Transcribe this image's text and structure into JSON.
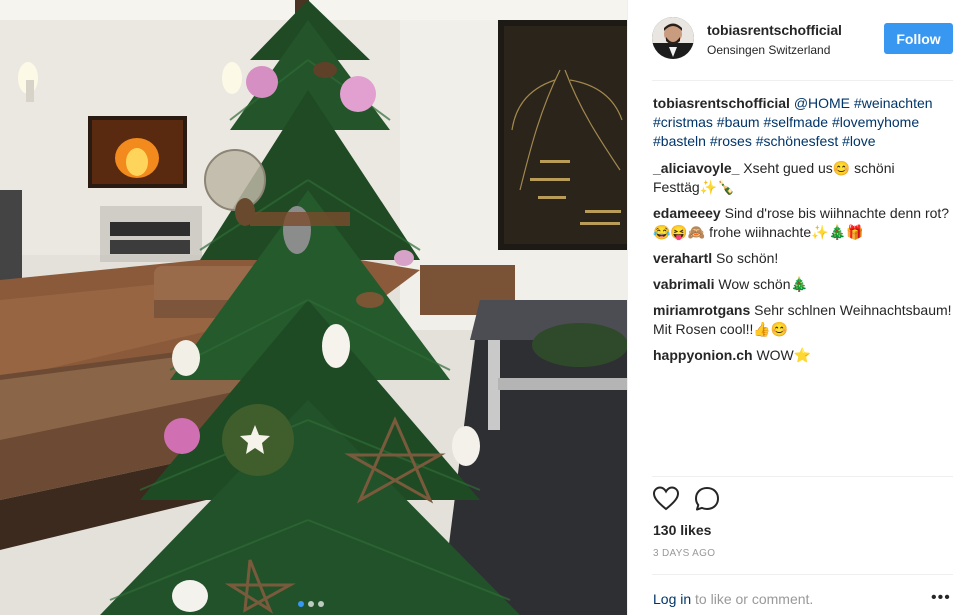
{
  "header": {
    "username": "tobiasrentschofficial",
    "location": "Oensingen Switzerland",
    "follow_label": "Follow"
  },
  "caption": {
    "username": "tobiasrentschofficial",
    "mention": "@HOME",
    "hashtags": "#weinachten #cristmas #baum #selfmade #lovemyhome #basteln #roses #schönesfest #love"
  },
  "comments": [
    {
      "username": "_aliciavoyle_",
      "text": "Xseht gued us😊 schöni Festtäg✨🍾"
    },
    {
      "username": "edameeey",
      "text": "Sind d'rose bis wiihnachte denn rot? 😂😝🙈 frohe wiihnachte✨🎄🎁"
    },
    {
      "username": "verahartl",
      "text": "So schön!"
    },
    {
      "username": "vabrimali",
      "text": "Wow schön🎄"
    },
    {
      "username": "miriamrotgans",
      "text": "Sehr schlnen Weihnachtsbaum! Mit Rosen cool!!👍😊"
    },
    {
      "username": "happyonion.ch",
      "text": "WOW⭐"
    }
  ],
  "icons": {
    "like": "heart-icon",
    "comment": "comment-bubble-icon",
    "more": "more-options-icon"
  },
  "likes_label": "130 likes",
  "time_ago": "3 DAYS AGO",
  "login": {
    "link_label": "Log in",
    "rest_label": " to like or comment.",
    "more_label": "•••"
  },
  "colors": {
    "follow_bg": "#3897f0",
    "link": "#003569",
    "muted": "#999999"
  }
}
